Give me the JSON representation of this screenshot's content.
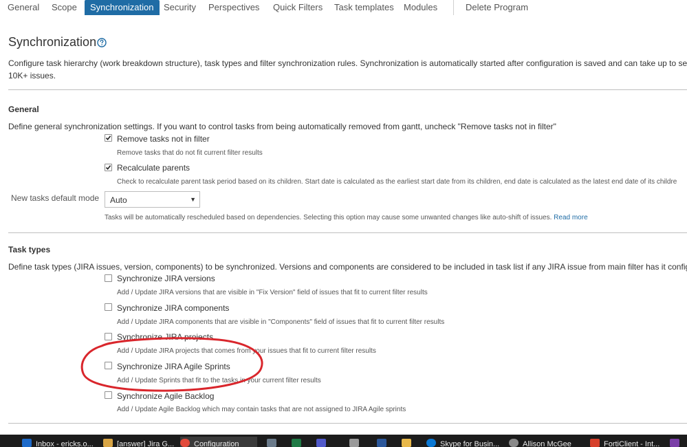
{
  "tabs": [
    "General",
    "Scope",
    "Synchronization",
    "Security",
    "Perspectives",
    "Quick Filters",
    "Task templates",
    "Modules"
  ],
  "delete_program": "Delete Program",
  "page": {
    "title": "Synchronization",
    "description_line1": "Configure task hierarchy (work breakdown structure), task types and filter synchronization rules. Synchronization is automatically started after configuration is saved and can take up to sev",
    "description_line2": "10K+ issues."
  },
  "general": {
    "title": "General",
    "description": "Define general synchronization settings. If you want to control tasks from being automatically removed from gantt, uncheck \"Remove tasks not in filter\"",
    "options": [
      {
        "label": "Remove tasks not in filter",
        "hint": "Remove tasks that do not fit current filter results",
        "checked": true
      },
      {
        "label": "Recalculate parents",
        "hint": "Check to recalculate parent task period based on its children. Start date is calculated as the earliest start date from its children, end date is calculated as the latest end date of its childre",
        "checked": true
      }
    ],
    "new_tasks_mode": {
      "label": "New tasks default mode",
      "value": "Auto",
      "hint": "Tasks will be automatically rescheduled based on dependencies. Selecting this option may cause some unwanted changes like auto-shift of issues.",
      "read_more": "Read more"
    }
  },
  "task_types": {
    "title": "Task types",
    "description": "Define task types (JIRA issues, version, components) to be synchronized. Versions and components are considered to be included in task list if any JIRA issue from main filter has it config",
    "options": [
      {
        "label": "Synchronize JIRA versions",
        "hint": "Add / Update JIRA versions that are visible in \"Fix Version\" field of issues that fit to current filter results",
        "checked": false
      },
      {
        "label": "Synchronize JIRA components",
        "hint": "Add / Update JIRA components that are visible in \"Components\" field of issues that fit to current filter results",
        "checked": false
      },
      {
        "label": "Synchronize JIRA projects",
        "hint": "Add / Update JIRA projects that comes from your issues that fit to current filter results",
        "checked": false
      },
      {
        "label": "Synchronize JIRA Agile Sprints",
        "hint": "Add / Update Sprints that fit to the tasks in your current filter results",
        "checked": false
      },
      {
        "label": "Synchronize Agile Backlog",
        "hint": "Add / Update Agile Backlog which may contain tasks that are not assigned to JIRA Agile sprints",
        "checked": false
      }
    ]
  },
  "taskbar": {
    "items": [
      "Inbox - ericks.o...",
      "[answer] Jira G...",
      "Configuration",
      "Skype for Busin...",
      "Allison McGee",
      "FortiClient - Int..."
    ]
  },
  "colors": {
    "accent": "#1f6ca5",
    "annotation": "#d9262c",
    "taskbar": "#1c1c1c"
  }
}
